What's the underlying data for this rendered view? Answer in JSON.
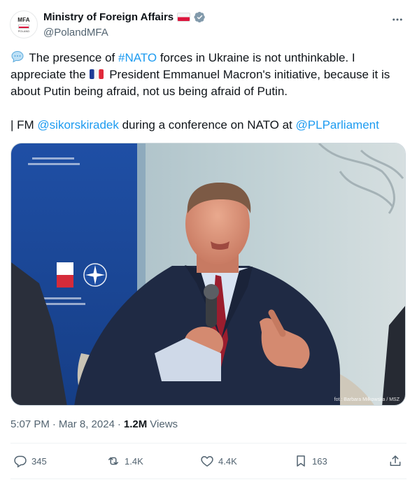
{
  "account": {
    "display_name": "Ministry of Foreign Affairs",
    "handle": "@PolandMFA",
    "avatar_text": "MFA",
    "avatar_subtext": "POLAND"
  },
  "tweet": {
    "line1_pre": " The presence of ",
    "line1_hashtag": "#NATO",
    "line1_post": " forces in Ukraine is not unthinkable. I appreciate the ",
    "line1_post2": " President Emmanuel Macron's initiative, because it is about Putin being afraid, not us being afraid of Putin.",
    "line2_pre": "| FM ",
    "line2_mention1": "@sikorskiradek",
    "line2_mid": " during a conference on NATO at ",
    "line2_mention2": "@PLParliament"
  },
  "photo": {
    "credit": "fot.: Barbara Miłkowska / MSZ"
  },
  "meta": {
    "time": "5:07 PM",
    "separator": "·",
    "date": "Mar 8, 2024",
    "views_count": "1.2M",
    "views_label": "Views"
  },
  "actions": {
    "replies": "345",
    "reposts": "1.4K",
    "likes": "4.4K",
    "bookmarks": "163"
  },
  "colors": {
    "link": "#1d9bf0",
    "secondary_text": "#536471",
    "primary_text": "#0f1419"
  }
}
